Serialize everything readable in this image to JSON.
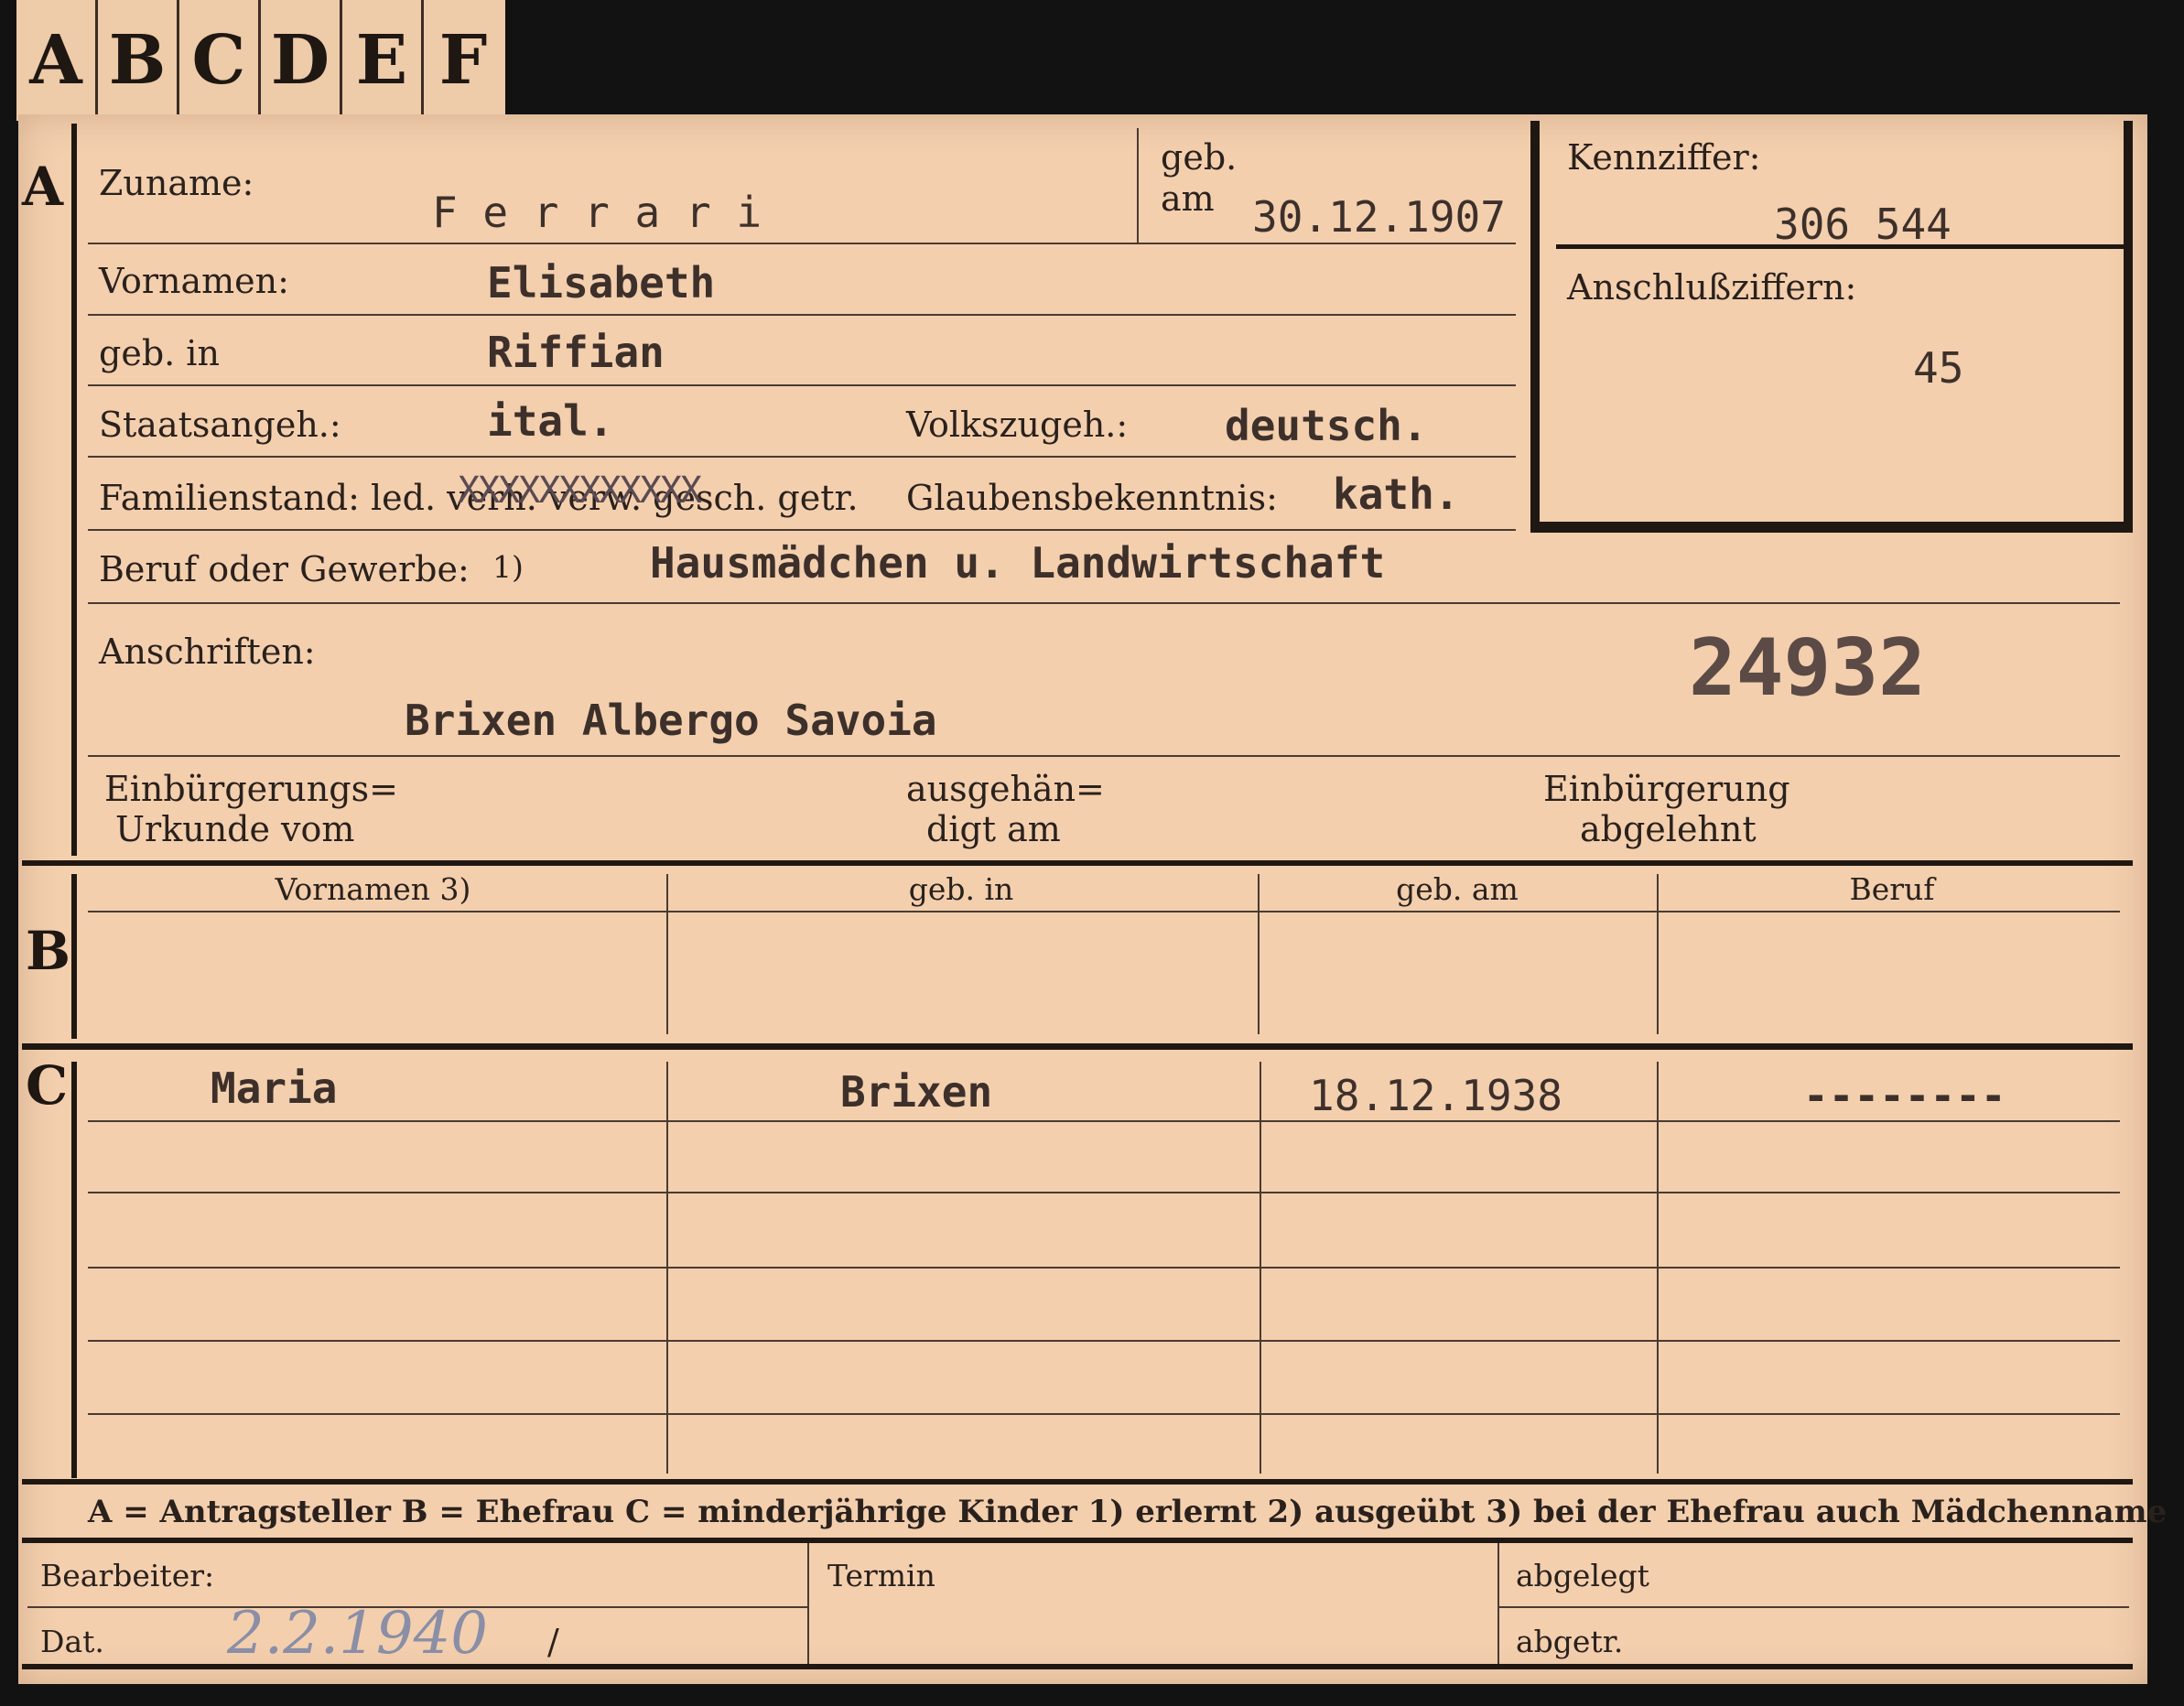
{
  "tabs": [
    "A",
    "B",
    "C",
    "D",
    "E",
    "F"
  ],
  "section_markers": {
    "a": "A",
    "b": "B",
    "c": "C"
  },
  "section_a": {
    "zuname_label": "Zuname:",
    "zuname": "F e r r a r i",
    "geb_label": "geb.",
    "am_label": "am",
    "geb_am": "30.12.1907",
    "vornamen_label": "Vornamen:",
    "vornamen": "Elisabeth",
    "geb_in_label": "geb. in",
    "geb_in": "Riffian",
    "staatsangeh_label": "Staatsangeh.:",
    "staatsangeh": "ital.",
    "volkszugeh_label": "Volkszugeh.:",
    "volkszugeh": "deutsch.",
    "familienstand_label": "Familienstand: led. verh. verw. gesch. getr.",
    "familienstand_strike": "XXXXXXXXXXXX",
    "glaubens_label": "Glaubensbekenntnis:",
    "glaubens": "kath.",
    "beruf_label": "Beruf oder Gewerbe:",
    "beruf_note": "1)",
    "beruf": "Hausmädchen u. Landwirtschaft",
    "anschriften_label": "Anschriften:",
    "anschrift": "Brixen Albergo Savoia",
    "stamp_number": "24932",
    "einb_urkunde_label_1": "Einbürgerungs=",
    "einb_urkunde_label_2": "Urkunde vom",
    "ausgeh_label_1": "ausgehän=",
    "ausgeh_label_2": "digt am",
    "einb_abgelehnt_label_1": "Einbürgerung",
    "einb_abgelehnt_label_2": "abgelehnt"
  },
  "kennziffer": {
    "label": "Kennziffer:",
    "value": "306 544",
    "anschluss_label": "Anschlußziffern:",
    "anschluss_value": "45"
  },
  "table_headers": [
    "Vornamen 3)",
    "geb. in",
    "geb. am",
    "Beruf"
  ],
  "children_rows": [
    {
      "vornamen": "Maria",
      "geb_in": "Brixen",
      "geb_am": "18.12.1938",
      "beruf": "--------"
    }
  ],
  "legend": "A = Antragsteller   B = Ehefrau   C = minderjährige Kinder   1) erlernt   2) ausgeübt   3) bei der Ehefrau auch Mädchenname",
  "footer": {
    "bearbeiter_label": "Bearbeiter:",
    "dat_label": "Dat.",
    "dat_value": "2.2.1940",
    "dat_slash": "/",
    "termin_label": "Termin",
    "abgelegt_label": "abgelegt",
    "abgetr_label": "abgetr."
  }
}
